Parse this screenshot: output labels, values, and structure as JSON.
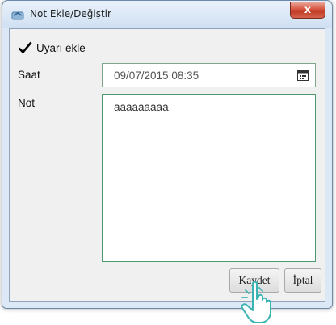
{
  "window": {
    "title": "Not Ekle/Değiştir",
    "close_label": "x"
  },
  "form": {
    "warning_checkbox": {
      "label": "Uyarı ekle",
      "checked": true
    },
    "time_label": "Saat",
    "time_value": "09/07/2015 08:35",
    "note_label": "Not",
    "note_value": "aaaaaaaaa"
  },
  "buttons": {
    "save_label": "Kaydet",
    "cancel_label": "İptal"
  },
  "colors": {
    "titlebar": "#dce8f5",
    "close_button": "#c9432d",
    "focus_border": "#4b9a6c"
  }
}
